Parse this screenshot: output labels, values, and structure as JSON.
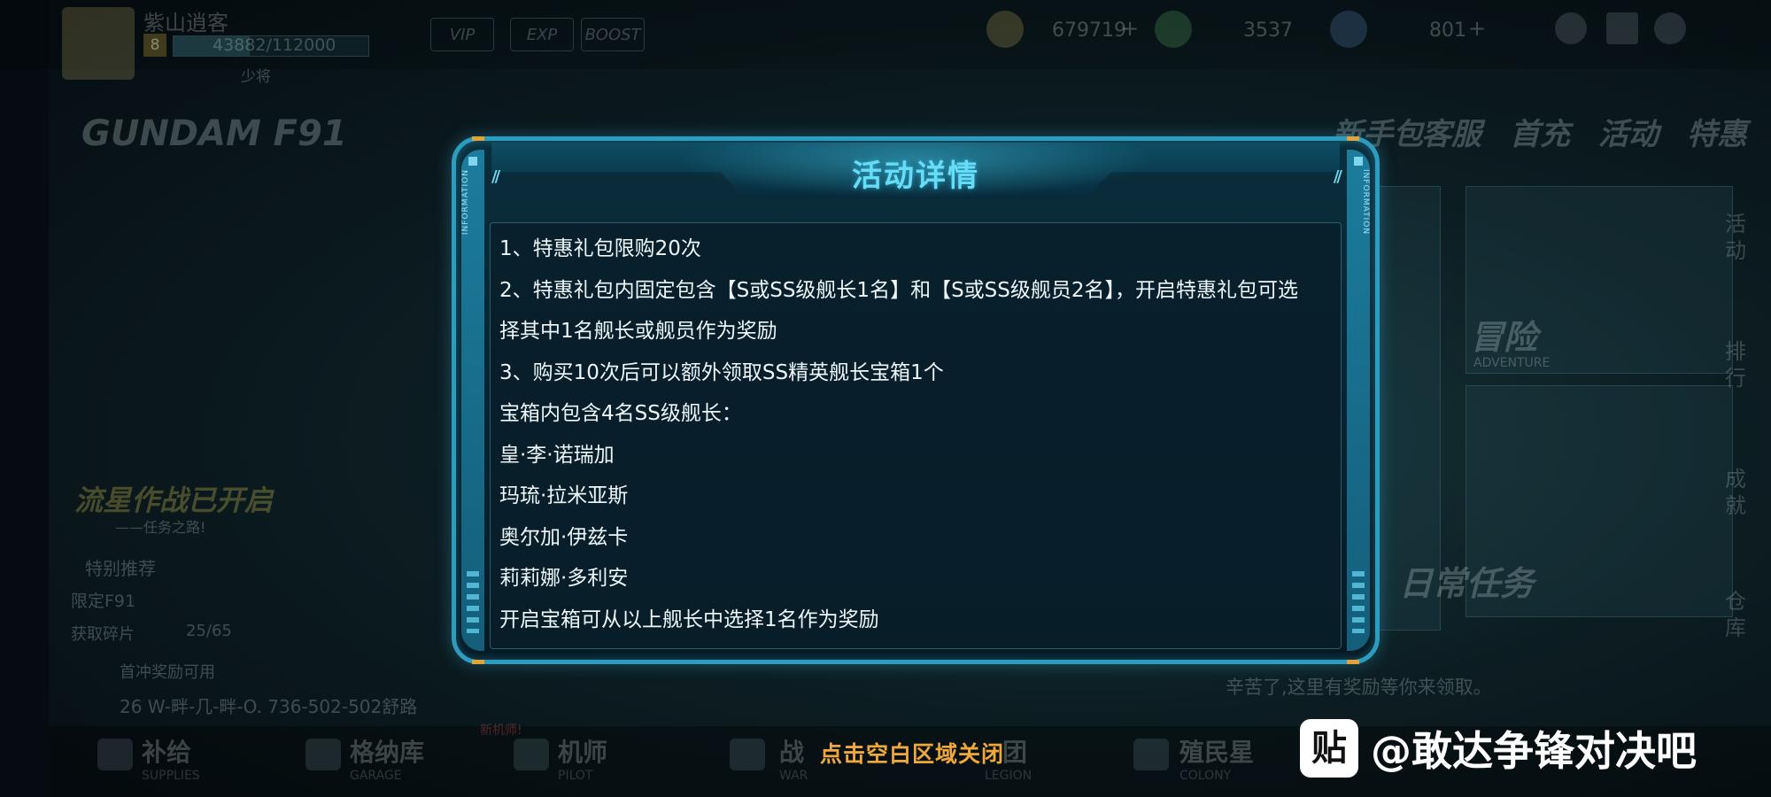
{
  "player": {
    "name": "紫山逍客",
    "level": "8",
    "exp": "43882/112000",
    "rank": "少将",
    "exp_progress": 0.39
  },
  "badges": [
    "VIP",
    "EXP",
    "BOOST"
  ],
  "resources": [
    {
      "icon": "gold-coin-icon",
      "value": "679719"
    },
    {
      "icon": "supply-icon",
      "value": "3537"
    },
    {
      "icon": "crystal-icon",
      "value": "801"
    }
  ],
  "background": {
    "logo": "GUNDAM F91",
    "event_banner": "流星作战已开启",
    "event_sub": "——任务之路!",
    "special_title": "特别推荐",
    "special_sub": "限定F91",
    "fragments_label": "获取碎片",
    "fragments_value": "25/65",
    "first_charge": "首冲奖励可用",
    "ticker": "26 W-畔-几-畔-O. 736-502-502舒路",
    "adventure_cn": "冒险",
    "adventure_en": "ADVENTURE",
    "daily_task": "日常任务",
    "hint": "辛苦了,这里有奖励等你来领取。",
    "top_menu": [
      "新手包",
      "客服",
      "首充",
      "活动",
      "特惠"
    ],
    "right_menu": [
      "活动",
      "排行",
      "成就",
      "仓库"
    ]
  },
  "nav": [
    {
      "label": "补给",
      "sub": "SUPPLIES"
    },
    {
      "label": "格纳库",
      "sub": "GARAGE"
    },
    {
      "label": "机师",
      "sub": "PILOT"
    },
    {
      "label": "战",
      "sub": "WAR"
    },
    {
      "label": "团",
      "sub": "LEGION"
    },
    {
      "label": "殖民星",
      "sub": "COLONY"
    }
  ],
  "new_tag": "新机师!",
  "dialog": {
    "title": "活动详情",
    "side_label_left": "INFORMATION",
    "side_label_right": "INFORMATION",
    "lines": [
      "1、特惠礼包限购20次",
      "2、特惠礼包内固定包含【S或SS级舰长1名】和【S或SS级舰员2名】，开启特惠礼包可选",
      "择其中1名舰长或舰员作为奖励",
      "3、购买10次后可以额外领取SS精英舰长宝箱1个",
      "宝箱内包含4名SS级舰长：",
      "皇·李·诺瑞加",
      "玛琉·拉米亚斯",
      "奥尔加·伊兹卡",
      "莉莉娜·多利安",
      "开启宝箱可从以上舰长中选择1名作为奖励"
    ]
  },
  "close_hint": "点击空白区域关闭",
  "watermark": {
    "logo": "贴",
    "text": "@敢达争锋对决吧"
  }
}
